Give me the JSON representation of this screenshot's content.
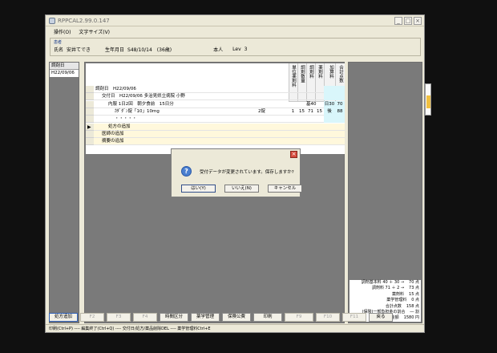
{
  "window": {
    "title": "RPPCAL2.99.0.147",
    "min": "_",
    "max": "□",
    "close": "×"
  },
  "menu": [
    {
      "label": "操作(O)"
    },
    {
      "label": "文字サイズ(V)"
    }
  ],
  "patient": {
    "caption": "患者",
    "name_label": "氏名",
    "name_value": "安井てでき",
    "birth_label": "生年月日",
    "birth_value": "S48/10/14　(36歳)",
    "self_label": "本人",
    "lev_label": "Lev",
    "lev_value": "3"
  },
  "dates": {
    "header": "調剤日",
    "items": [
      "H22/09/06"
    ]
  },
  "grid": {
    "columns": [
      "単位薬剤料",
      "調剤数量",
      "調剤料",
      "薬剤料",
      "加算料",
      "合計点数"
    ],
    "rows": [
      {
        "text": "調剤日　H22/09/06",
        "indent": 1,
        "yellow": false,
        "cells": [
          "",
          "",
          "",
          "",
          "",
          ""
        ]
      },
      {
        "text": "交付日　H22/09/06 多治見県立病院 小野",
        "indent": 2,
        "yellow": false,
        "cells": [
          "",
          "",
          "",
          "",
          "",
          ""
        ]
      },
      {
        "text": "内服 1日2回　朝夕食前　15日分",
        "indent": 3,
        "yellow": false,
        "cells": [
          "",
          "",
          "基40",
          "",
          "日30",
          "70"
        ]
      },
      {
        "text": "ｶﾀﾞﾀﾞﾝ錠「10」10mg",
        "qty": "2錠",
        "indent": 4,
        "yellow": false,
        "cells": [
          "1",
          "15",
          "71",
          "15",
          "後発2",
          "88"
        ]
      },
      {
        "text": "・・・・・",
        "indent": 4,
        "yellow": false,
        "cells": [
          "",
          "",
          "",
          "",
          "",
          ""
        ]
      },
      {
        "text": "処方の追加",
        "indent": 3,
        "yellow": true,
        "current": true,
        "cells": [
          "",
          "",
          "",
          "",
          "",
          ""
        ]
      },
      {
        "text": "医師の追加",
        "indent": 2,
        "yellow": true,
        "cells": [
          "",
          "",
          "",
          "",
          "",
          ""
        ]
      },
      {
        "text": "摘要の追加",
        "indent": 2,
        "yellow": true,
        "cells": [
          "",
          "",
          "",
          "",
          "",
          ""
        ]
      }
    ],
    "row4_extra": "後"
  },
  "summary": [
    {
      "label": "調剤基本料 40 ＋ 30 →",
      "value": "70 点"
    },
    {
      "label": "調剤料 71 ＋ 2 →",
      "value": "73 点"
    },
    {
      "label": "薬剤料",
      "value": "15 点"
    },
    {
      "label": "薬学管理料",
      "value": "0 点"
    },
    {
      "label": "合計点数",
      "value": "158 点"
    },
    {
      "label": "(保険)一部負担金の割合",
      "value": "― 割"
    },
    {
      "label": "患者負担金額",
      "value": "1580 円"
    }
  ],
  "buttons": [
    {
      "label": "処方追加",
      "enabled": true,
      "focus": true,
      "w": 36
    },
    {
      "label": "F2",
      "enabled": false,
      "w": 30
    },
    {
      "label": "F3",
      "enabled": false,
      "w": 30
    },
    {
      "label": "F4",
      "enabled": false,
      "w": 30
    },
    {
      "label": "時間区分",
      "enabled": true,
      "w": 36
    },
    {
      "label": "薬学管理",
      "enabled": true,
      "w": 36
    },
    {
      "label": "保険公費",
      "enabled": true,
      "w": 36
    },
    {
      "label": "印刷",
      "enabled": true,
      "w": 36
    },
    {
      "label": "F9",
      "enabled": false,
      "w": 36
    },
    {
      "label": "F10",
      "enabled": false,
      "w": 30
    },
    {
      "label": "F11",
      "enabled": false,
      "w": 30
    },
    {
      "label": "戻る",
      "enabled": true,
      "w": 30
    }
  ],
  "statusbar": "印刷(Ctrl+P) ---- 編集終了(Ctrl+Q) ---- 交付日/処方/薬品削除DEL ---- 薬学管理料Ctrl+E",
  "dialog": {
    "title_close": "×",
    "message": "受付データが変更されています。保存しますか?",
    "icon": "?",
    "yes": "はい(Y)",
    "no": "いいえ(N)",
    "cancel": "キャンセル"
  }
}
